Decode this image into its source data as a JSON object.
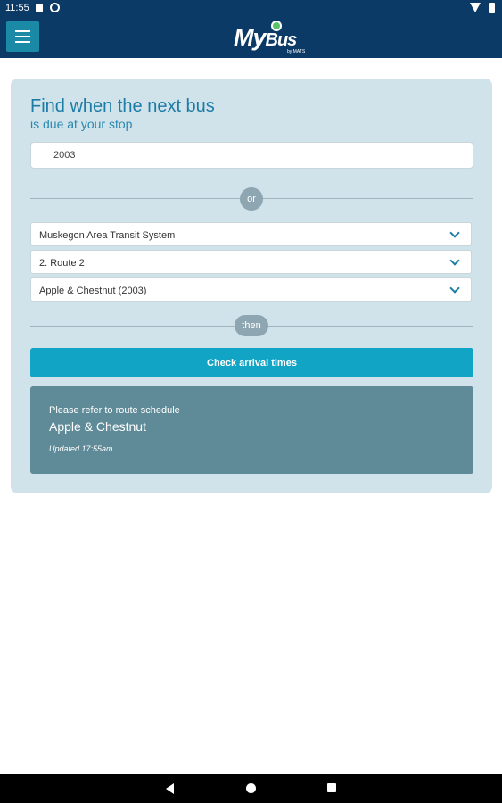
{
  "status_bar": {
    "time": "11:55"
  },
  "app_bar": {
    "logo_main": "My",
    "logo_bus": "Bus",
    "logo_sub": "by MATS"
  },
  "finder": {
    "title": "Find when the next bus",
    "subtitle": "is due at your stop",
    "stop_value": "2003",
    "or_label": "or",
    "then_label": "then",
    "agency": "Muskegon Area Transit System",
    "route": "2. Route 2",
    "stop": "Apple & Chestnut (2003)",
    "check_button": "Check arrival times"
  },
  "result": {
    "note": "Please refer to route schedule",
    "stop_name": "Apple & Chestnut",
    "updated": "Updated 17:55am"
  },
  "colors": {
    "header": "#0c3a66",
    "accent": "#12a4c4",
    "card": "#d0e2ea",
    "result_panel": "#5f8a98"
  },
  "icons": {
    "menu": "hamburger-icon",
    "dropdown": "chevron-down-icon",
    "nav_back": "back-triangle-icon",
    "nav_home": "home-circle-icon",
    "nav_recent": "recent-square-icon"
  }
}
